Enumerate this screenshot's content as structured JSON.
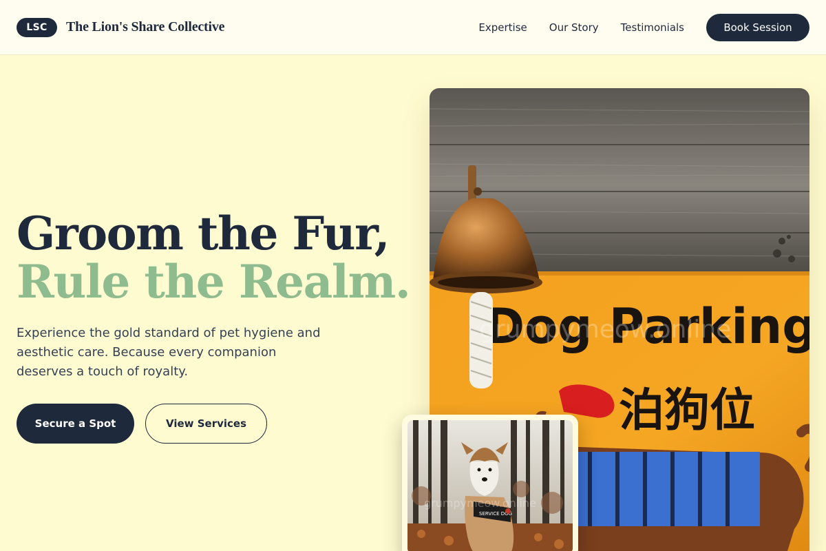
{
  "header": {
    "logo_badge": "LSC",
    "brand_name": "The Lion's Share Collective",
    "nav": [
      {
        "label": "Expertise"
      },
      {
        "label": "Our Story"
      },
      {
        "label": "Testimonials"
      }
    ],
    "cta_label": "Book Session"
  },
  "hero": {
    "title_line1": "Groom the Fur,",
    "title_line2": "Rule the Realm.",
    "subtitle": "Experience the gold standard of pet hygiene and aesthetic care. Because every companion deserves a touch of royalty.",
    "primary_label": "Secure a Spot",
    "secondary_label": "View Services"
  },
  "images": {
    "main": {
      "sign_text_en": "Dog Parking",
      "sign_text_cn": "泊狗位",
      "watermark": "grumpymeow.online"
    },
    "inset": {
      "watermark": "grumpymeow.online",
      "harness_text": "SERVICE DOG"
    }
  },
  "colors": {
    "navy": "#1e293b",
    "sage": "#8fbc8f",
    "cream": "#fffbd0"
  }
}
